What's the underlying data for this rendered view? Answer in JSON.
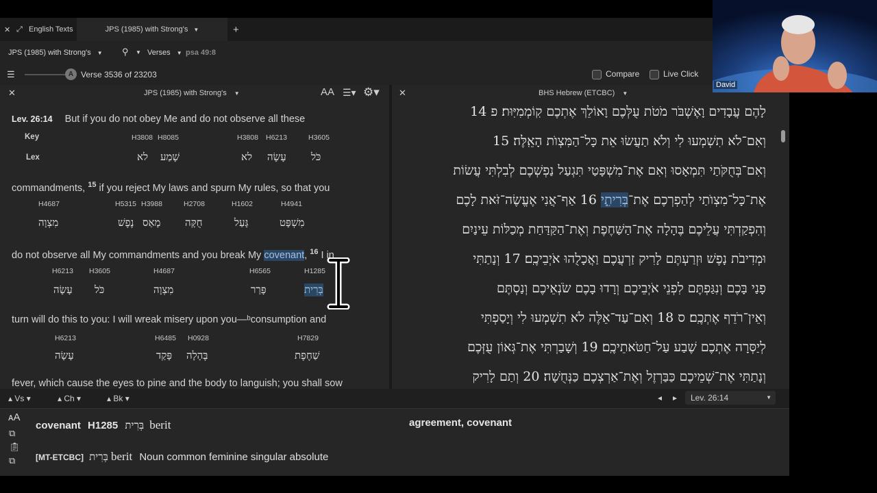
{
  "tabs": {
    "english_texts": "English Texts",
    "jps_tab": "JPS (1985) with Strong's",
    "add": "+"
  },
  "toolbar": {
    "resource": "JPS (1985) with Strong's",
    "search_mode": "Verses",
    "reference": "psa 49:8"
  },
  "toolbar2": {
    "verse_badge": "A",
    "verse_counter": "Verse 3536 of 23203",
    "compare": "Compare",
    "live_click": "Live Click"
  },
  "left_pane": {
    "title": "JPS (1985) with Strong's",
    "font_size_icon": "AA",
    "key_label": "Key",
    "lex_label": "Lex",
    "lines": [
      {
        "ref": "Lev. 26:14",
        "text": "But if you do   not obey Me and do   not observe    all these"
      },
      {
        "text_a": "commandments,",
        "vnum": "15",
        "text_b": "if  you reject My laws and spurn My  rules, so that you"
      },
      {
        "text_a": "do not observe    all My commandments and you break My",
        "highlight": "covenant",
        "text_b": ",",
        "vnum": "16",
        "text_c": "I in"
      },
      {
        "text": "turn will    do this to you: I will wreak misery upon you—ᵇconsumption and"
      },
      {
        "text": "fever, which cause the eyes to pine and the body to languish; you shall sow"
      }
    ],
    "strongs_rows": [
      {
        "codes": [
          "H3808",
          "H8085",
          "H3808",
          "H6213",
          "H3605"
        ],
        "lex": [
          "לא",
          "שָׁמַע",
          "לא",
          "עָשָׂה",
          "כֹּל"
        ]
      },
      {
        "codes": [
          "H4687",
          "H5315",
          "H3988",
          "H2708",
          "H1602",
          "H4941"
        ],
        "lex": [
          "מִצְוָה",
          "נֶפֶשׁ",
          "מָאַס",
          "חֻקָּה",
          "גָּעַל",
          "מִשְׁפָּט"
        ]
      },
      {
        "codes": [
          "H6213",
          "H3605",
          "H4687",
          "H6565",
          "H1285"
        ],
        "lex": [
          "עָשָׂה",
          "כֹּל",
          "מִצְוָה",
          "פָּרַר",
          "בְּרִית"
        ]
      },
      {
        "codes": [
          "H6213",
          "H6485",
          "H0928",
          "H7829"
        ],
        "lex": [
          "עָשָׂה",
          "פָּקַד",
          "בֶּהָלָה",
          "שַׁחֶפֶת"
        ]
      }
    ]
  },
  "right_pane": {
    "title": "BHS Hebrew (ETCBC)",
    "lines": [
      "לָהֶם עֲבָדִים וָאֶשְׁבֹּר מֹטֹת עֻלְּכֶם וָאוֹלֵךְ אֶתְכֶם קֽוֹמְמִיּֽוּת׃ פ 14",
      "וְאִם־לֹא תִשְׁמְעוּ לִי וְלֹא תַעֲשׂוּ אֵת כָּל־הַמִּצְוֺת הָאֵֽלֶּה׃ 15",
      "וְאִם־בְּחֻקֹּתַי תִּמְאָסוּ וְאִם אֶת־מִשְׁפָּטַי תִּגְעַל נַפְשְׁכֶם לְבִלְתִּי עֲשׂוֹת",
      "אֶת־כָּל־מִצְוֺתַי לְהַפְרְכֶם אֶת־",
      "וְהִפְקַדְתִּי עֲלֵיכֶם בֶּהָלָה אֶת־הַשַּׁחֶפֶת וְאֶת־הַקַּדַּחַת מְכַלּוֹת עֵינַיִם",
      "וּמְדִיבֹת נָפֶשׁ וּזְרַעְתֶּם לָרִיק זַרְעֲכֶם וַאֲכָלֻהוּ אֹיְבֵיכֶֽם׃ 17 וְנָתַתִּי",
      "פָנַי בָּכֶם וְנִגַּפְתֶּם לִפְנֵי אֹיְבֵיכֶם וְרָדוּ בָכֶם שֹׂנְאֵיכֶם וְנַסְתֶּם",
      "וְאֵין־רֹדֵף אֶתְכֶֽם׃ ס 18 וְאִם־עַד־אֵלֶּה לֹא תִשְׁמְעוּ לִי וְיָסַפְתִּי",
      "לְיַסְּרָה אֶתְכֶם שֶׁבַע עַל־חַטֹּאתֵיכֶֽם׃ 19 וְשָׁבַרְתִּי אֶת־גְּאוֹן עֻזְּכֶם",
      "וְנָתַתִּי אֶת־שְׁמֵיכֶם כַּבַּרְזֶל וְאֶת־אַרְצְכֶם כַּנְּחֻשָׁה׃ 20 וְתַם לָרִיק"
    ],
    "line4_highlight": "בְּרִיתִ֑י",
    "line4_rest": "׃ 16 אַף־אֲנִי אֶעֱשֶׂה־זֹּאת לָכֶם"
  },
  "footer": {
    "vs": "Vs",
    "ch": "Ch",
    "bk": "Bk",
    "reference": "Lev. 26:14"
  },
  "info": {
    "word": "covenant",
    "strong": "H1285",
    "hebrew": "בְּרִית",
    "translit": "berit",
    "gloss": "agreement, covenant",
    "morph_source": "[MT-ETCBC]",
    "morph_hebrew": "בְּרִית",
    "morph_translit": "berit",
    "morph": "Noun common feminine singular absolute"
  },
  "video": {
    "name": "David"
  }
}
